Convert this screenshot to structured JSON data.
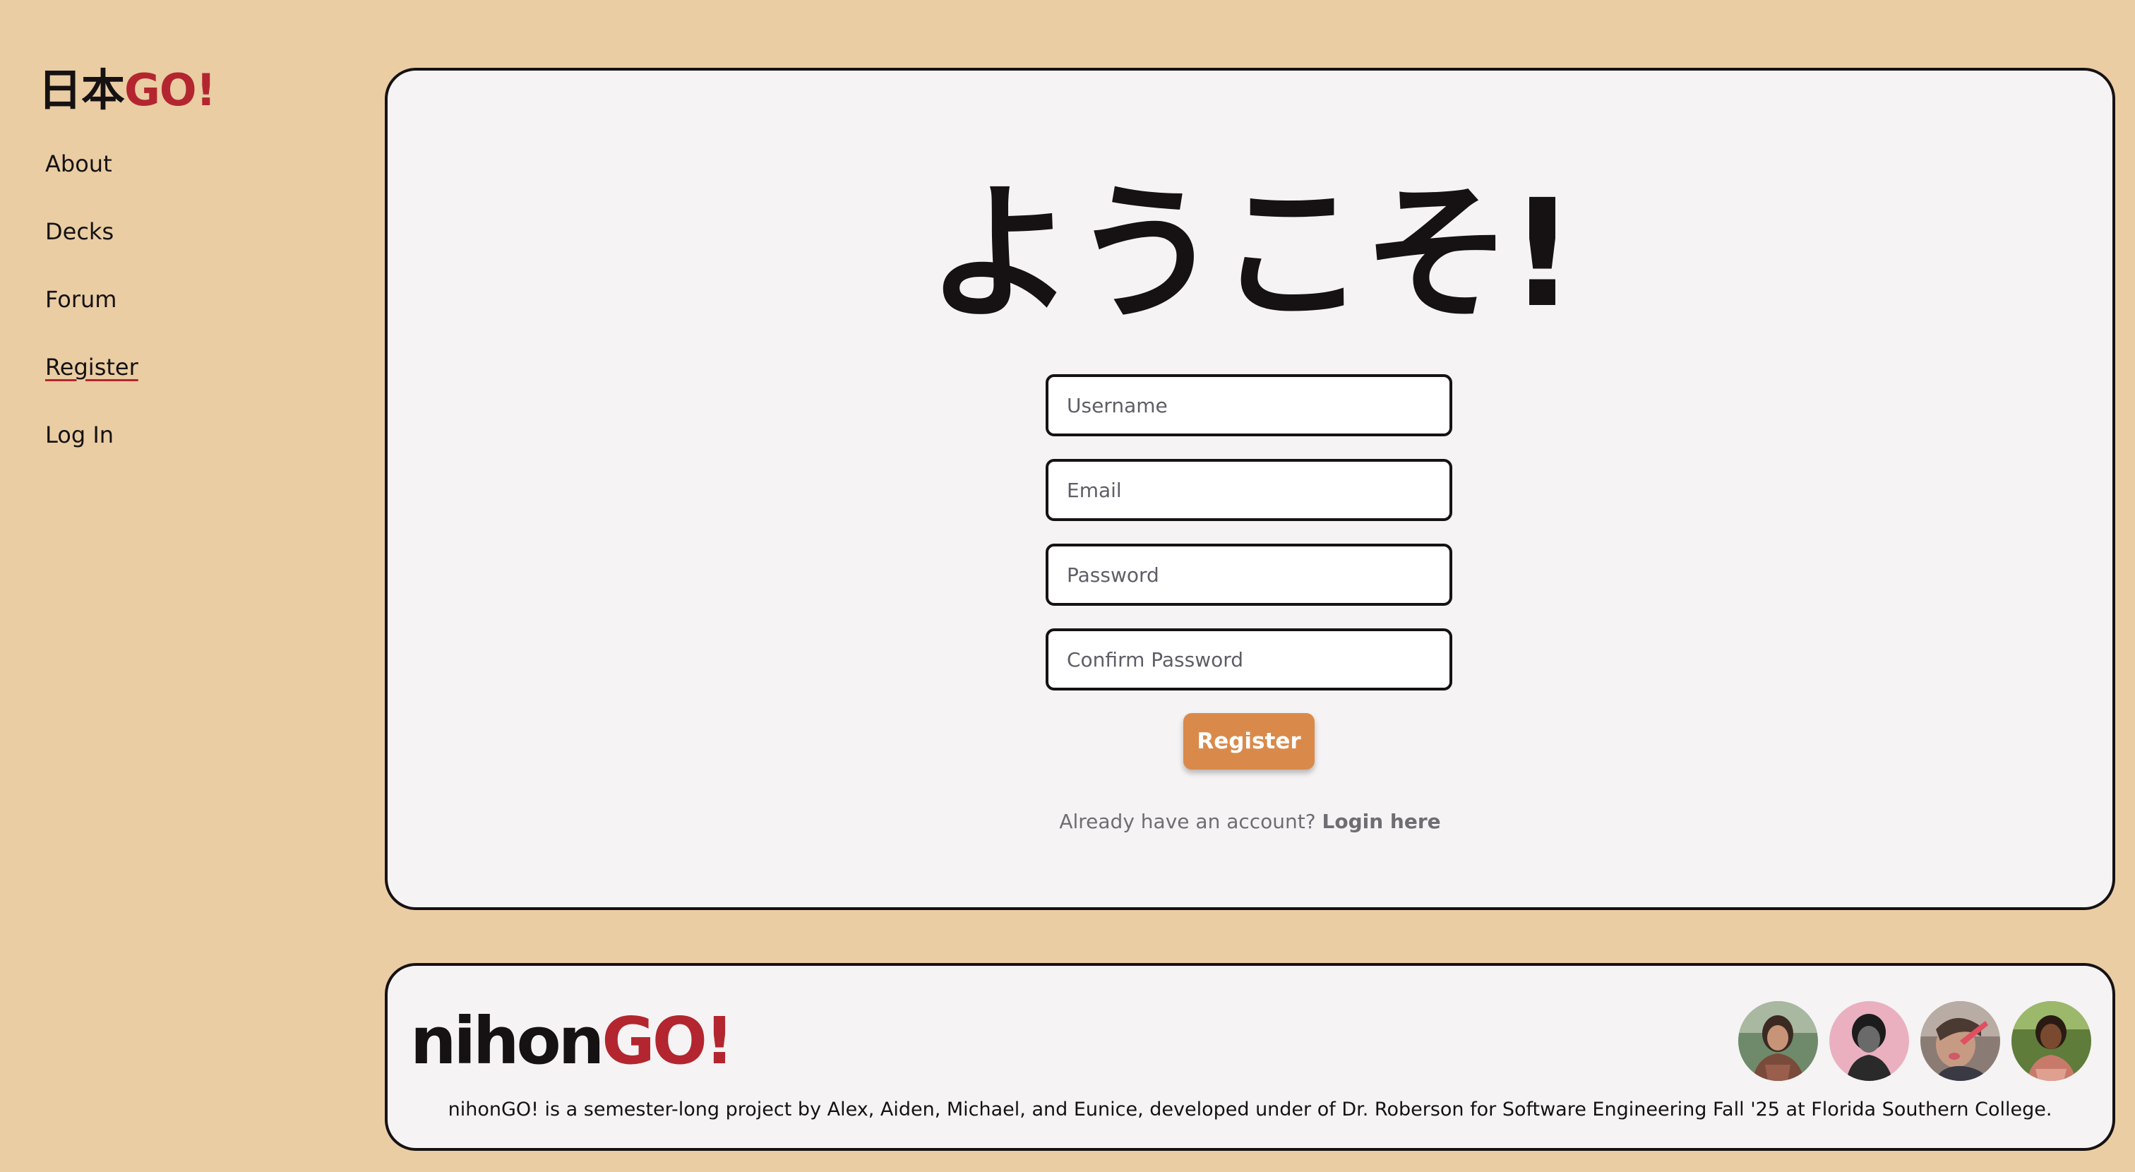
{
  "sidebar": {
    "logo": {
      "kanji": "日本",
      "go": "GO!"
    },
    "nav": [
      {
        "label": "About",
        "active": false
      },
      {
        "label": "Decks",
        "active": false
      },
      {
        "label": "Forum",
        "active": false
      },
      {
        "label": "Register",
        "active": true
      },
      {
        "label": "Log In",
        "active": false
      }
    ]
  },
  "main": {
    "title": "ようこそ!",
    "form": {
      "username_placeholder": "Username",
      "email_placeholder": "Email",
      "password_placeholder": "Password",
      "confirm_password_placeholder": "Confirm Password",
      "submit_label": "Register"
    },
    "login_prompt": "Already have an account?",
    "login_link": "Login here"
  },
  "footer": {
    "brand_nihon": "nihon",
    "brand_go": "GO!",
    "description": "nihonGO! is a semester-long project by Alex, Aiden, Michael, and Eunice, developed under of Dr. Roberson for Software Engineering Fall '25 at Florida Southern College.",
    "avatars": [
      "avatar-photo",
      "avatar-photo",
      "avatar-photo",
      "avatar-photo"
    ]
  },
  "colors": {
    "background": "#eacda3",
    "card": "#f5f3f4",
    "accent_red": "#b3262f",
    "button": "#d98a4a",
    "text": "#161213"
  }
}
